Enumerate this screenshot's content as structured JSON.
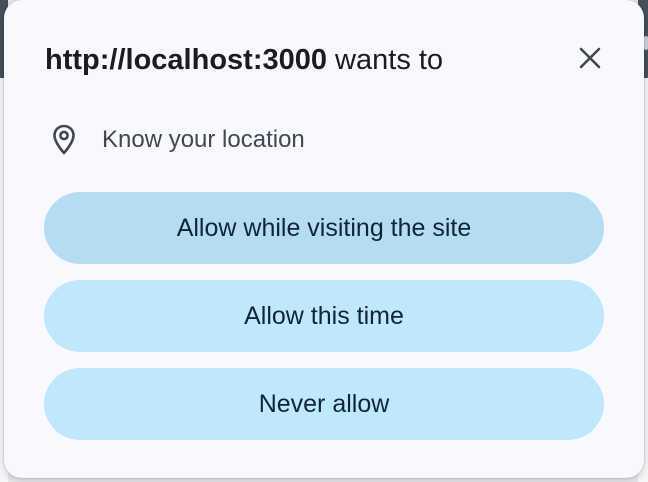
{
  "dialog": {
    "title_host": "http://localhost:3000",
    "title_suffix": " wants to",
    "close_icon": "close-icon",
    "permission": {
      "icon": "location-pin-icon",
      "label": "Know your location"
    },
    "buttons": [
      {
        "label": "Allow while visiting the site"
      },
      {
        "label": "Allow this time"
      },
      {
        "label": "Never allow"
      }
    ]
  },
  "colors": {
    "dialog_bg": "#f8f9ff",
    "button_bg": "#bfe8fc",
    "button_hover_bg": "#b4ddf3",
    "button_text": "#0e2636",
    "title_text": "#1b1c1f"
  }
}
